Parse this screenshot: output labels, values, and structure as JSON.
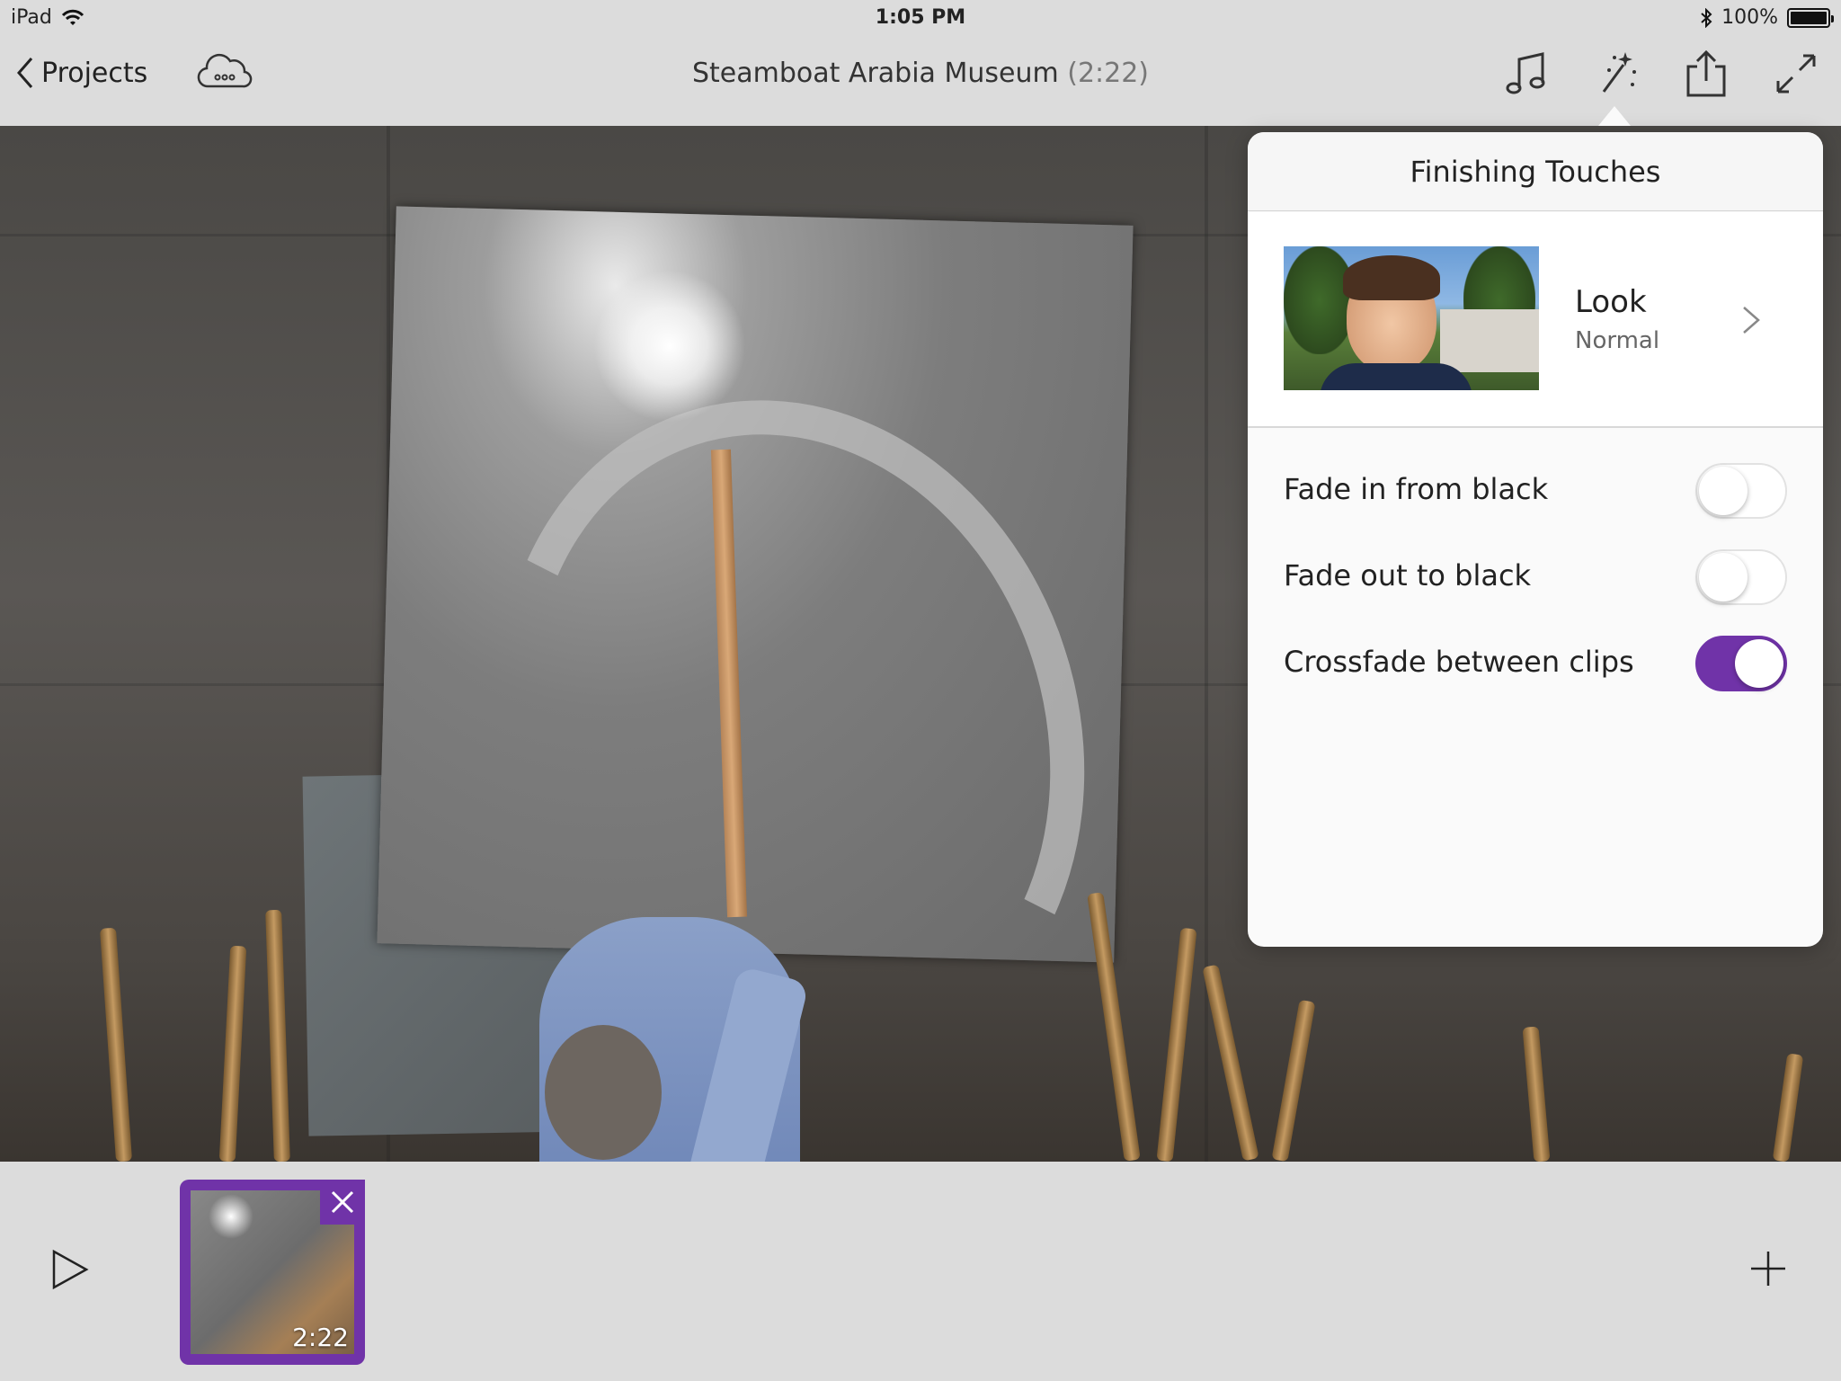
{
  "status_bar": {
    "device": "iPad",
    "time": "1:05 PM",
    "battery": "100%"
  },
  "nav": {
    "back_label": "Projects",
    "project_title": "Steamboat Arabia Museum",
    "project_duration": "(2:22)",
    "icons": [
      "cloud-icon",
      "music-icon",
      "magic-wand-icon",
      "share-icon",
      "fullscreen-icon"
    ]
  },
  "popover": {
    "title": "Finishing Touches",
    "look": {
      "title": "Look",
      "value": "Normal"
    },
    "options": [
      {
        "label": "Fade in from black",
        "on": false
      },
      {
        "label": "Fade out to black",
        "on": false
      },
      {
        "label": "Crossfade between clips",
        "on": true
      }
    ]
  },
  "timeline": {
    "clip_duration": "2:22"
  },
  "colors": {
    "accent": "#7033a8",
    "chrome": "#dcdcdc"
  }
}
